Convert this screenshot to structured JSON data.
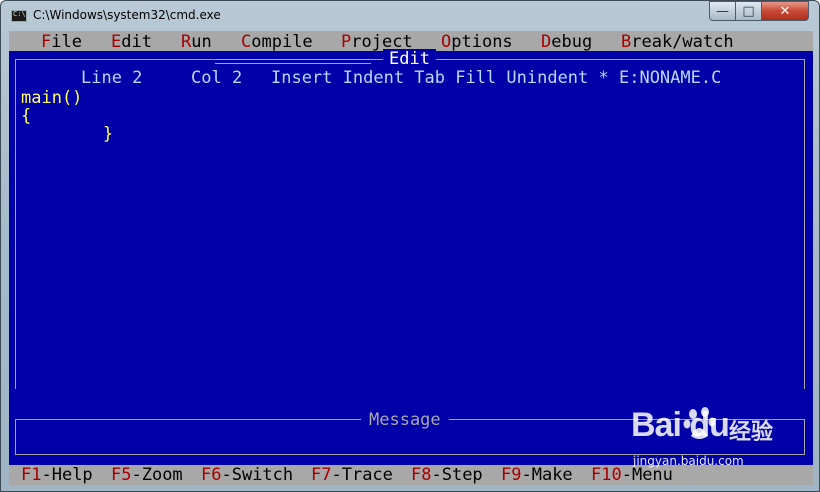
{
  "window": {
    "title": "C:\\Windows\\system32\\cmd.exe",
    "min_glyph": "—",
    "max_glyph": "□",
    "close_glyph": "✕"
  },
  "menu": {
    "items": [
      {
        "hotkey": "F",
        "rest": "ile"
      },
      {
        "hotkey": "E",
        "rest": "dit"
      },
      {
        "hotkey": "R",
        "rest": "un"
      },
      {
        "hotkey": "C",
        "rest": "ompile"
      },
      {
        "hotkey": "P",
        "rest": "roject"
      },
      {
        "hotkey": "O",
        "rest": "ptions"
      },
      {
        "hotkey": "D",
        "rest": "ebug"
      },
      {
        "hotkey": "B",
        "rest": "reak/watch"
      }
    ]
  },
  "editor": {
    "title": "Edit",
    "status": {
      "line": "Line 2",
      "col": "Col 2",
      "modes": "Insert Indent Tab Fill Unindent * E:NONAME.C"
    },
    "code": [
      "main()",
      "{",
      "        }"
    ]
  },
  "message": {
    "title": "Message"
  },
  "function_keys": [
    {
      "key": "F1",
      "label": "-Help"
    },
    {
      "key": "F5",
      "label": "-Zoom"
    },
    {
      "key": "F6",
      "label": "-Switch"
    },
    {
      "key": "F7",
      "label": "-Trace"
    },
    {
      "key": "F8",
      "label": "-Step"
    },
    {
      "key": "F9",
      "label": "-Make"
    },
    {
      "key": "F10",
      "label": "-Menu"
    }
  ],
  "watermark": {
    "logo": "Bai  du",
    "suffix": "经验",
    "url": "jingyan.baidu.com"
  },
  "colors": {
    "console_bg": "#0000a8",
    "bar_bg": "#a8a8a8",
    "hotkey": "#a80000",
    "code": "#ffff55"
  }
}
